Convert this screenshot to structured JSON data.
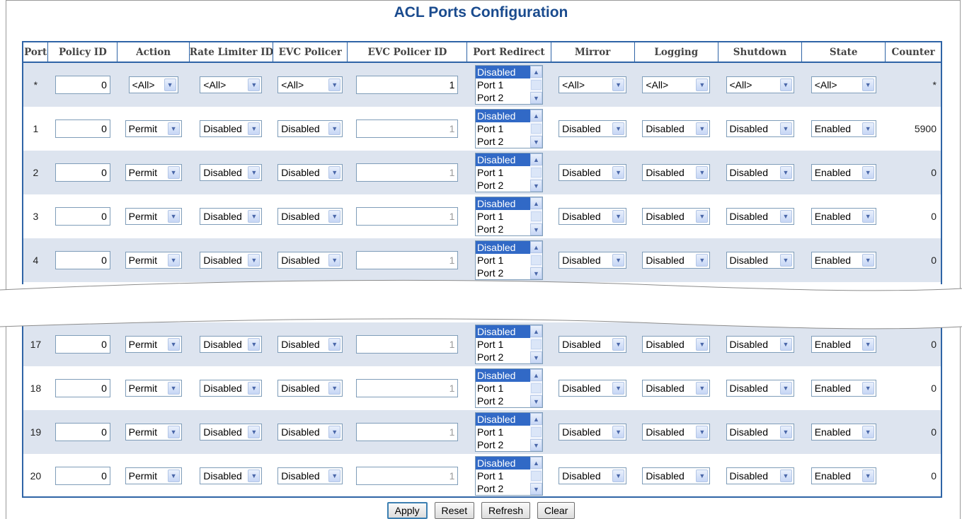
{
  "page": {
    "title": "ACL Ports Configuration"
  },
  "columns": [
    "Port",
    "Policy ID",
    "Action",
    "Rate Limiter ID",
    "EVC Policer",
    "EVC Policer ID",
    "Port Redirect",
    "Mirror",
    "Logging",
    "Shutdown",
    "State",
    "Counter"
  ],
  "redirect_options": [
    "Disabled",
    "Port 1",
    "Port 2"
  ],
  "rows_top": [
    {
      "port": "*",
      "policy_id": "0",
      "action": "<All>",
      "rate_limiter": "<All>",
      "evc_policer": "<All>",
      "evc_policer_id": "1",
      "mirror": "<All>",
      "logging": "<All>",
      "shutdown": "<All>",
      "state": "<All>",
      "counter": "*"
    },
    {
      "port": "1",
      "policy_id": "0",
      "action": "Permit",
      "rate_limiter": "Disabled",
      "evc_policer": "Disabled",
      "evc_policer_id": "1",
      "mirror": "Disabled",
      "logging": "Disabled",
      "shutdown": "Disabled",
      "state": "Enabled",
      "counter": "5900"
    },
    {
      "port": "2",
      "policy_id": "0",
      "action": "Permit",
      "rate_limiter": "Disabled",
      "evc_policer": "Disabled",
      "evc_policer_id": "1",
      "mirror": "Disabled",
      "logging": "Disabled",
      "shutdown": "Disabled",
      "state": "Enabled",
      "counter": "0"
    },
    {
      "port": "3",
      "policy_id": "0",
      "action": "Permit",
      "rate_limiter": "Disabled",
      "evc_policer": "Disabled",
      "evc_policer_id": "1",
      "mirror": "Disabled",
      "logging": "Disabled",
      "shutdown": "Disabled",
      "state": "Enabled",
      "counter": "0"
    },
    {
      "port": "4",
      "policy_id": "0",
      "action": "Permit",
      "rate_limiter": "Disabled",
      "evc_policer": "Disabled",
      "evc_policer_id": "1",
      "mirror": "Disabled",
      "logging": "Disabled",
      "shutdown": "Disabled",
      "state": "Enabled",
      "counter": "0"
    }
  ],
  "rows_bottom": [
    {
      "port": "17",
      "policy_id": "0",
      "action": "Permit",
      "rate_limiter": "Disabled",
      "evc_policer": "Disabled",
      "evc_policer_id": "1",
      "mirror": "Disabled",
      "logging": "Disabled",
      "shutdown": "Disabled",
      "state": "Enabled",
      "counter": "0"
    },
    {
      "port": "18",
      "policy_id": "0",
      "action": "Permit",
      "rate_limiter": "Disabled",
      "evc_policer": "Disabled",
      "evc_policer_id": "1",
      "mirror": "Disabled",
      "logging": "Disabled",
      "shutdown": "Disabled",
      "state": "Enabled",
      "counter": "0"
    },
    {
      "port": "19",
      "policy_id": "0",
      "action": "Permit",
      "rate_limiter": "Disabled",
      "evc_policer": "Disabled",
      "evc_policer_id": "1",
      "mirror": "Disabled",
      "logging": "Disabled",
      "shutdown": "Disabled",
      "state": "Enabled",
      "counter": "0"
    },
    {
      "port": "20",
      "policy_id": "0",
      "action": "Permit",
      "rate_limiter": "Disabled",
      "evc_policer": "Disabled",
      "evc_policer_id": "1",
      "mirror": "Disabled",
      "logging": "Disabled",
      "shutdown": "Disabled",
      "state": "Enabled",
      "counter": "0"
    }
  ],
  "buttons": {
    "apply": "Apply",
    "reset": "Reset",
    "refresh": "Refresh",
    "clear": "Clear"
  },
  "colors": {
    "accent": "#2f64a6",
    "title": "#1a4b8e",
    "row_alt": "#dde4ef",
    "selection": "#3169c6"
  },
  "icons": {
    "dropdown": "chevron-down-icon",
    "scroll_up": "scroll-up-icon",
    "scroll_down": "scroll-down-icon"
  }
}
